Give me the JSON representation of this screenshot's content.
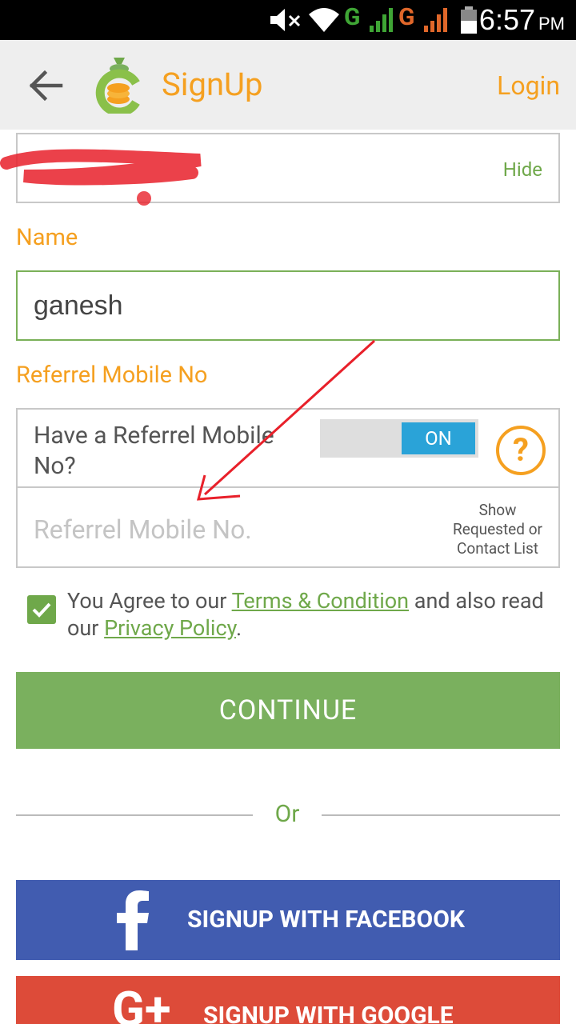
{
  "status_bar": {
    "time": "6:57",
    "ampm": "PM"
  },
  "app_bar": {
    "title": "SignUp",
    "login_label": "Login"
  },
  "password": {
    "toggle_label": "Hide"
  },
  "name": {
    "label": "Name",
    "value": "ganesh"
  },
  "referral": {
    "label": "Referrel Mobile No",
    "question": "Have a Referrel Mobile No?",
    "toggle_state": "ON",
    "input_placeholder": "Referrel Mobile No.",
    "show_list_label": "Show Requested or Contact List"
  },
  "agreement": {
    "checked": true,
    "prefix": "You Agree to our",
    "terms_link": "Terms & Condition",
    "middle": "and also read our",
    "privacy_link": "Privacy Policy",
    "suffix": "."
  },
  "continue_label": "CONTINUE",
  "separator": "Or",
  "social": {
    "facebook_label": "SIGNUP WITH FACEBOOK",
    "google_label": "SIGNUP WITH GOOGLE"
  },
  "colors": {
    "accent_orange": "#f5a020",
    "primary_green": "#7ab05e",
    "link_green": "#6fa84a",
    "facebook_blue": "#415cb0",
    "google_red": "#dd4b39",
    "toggle_blue": "#2aa3d8"
  }
}
